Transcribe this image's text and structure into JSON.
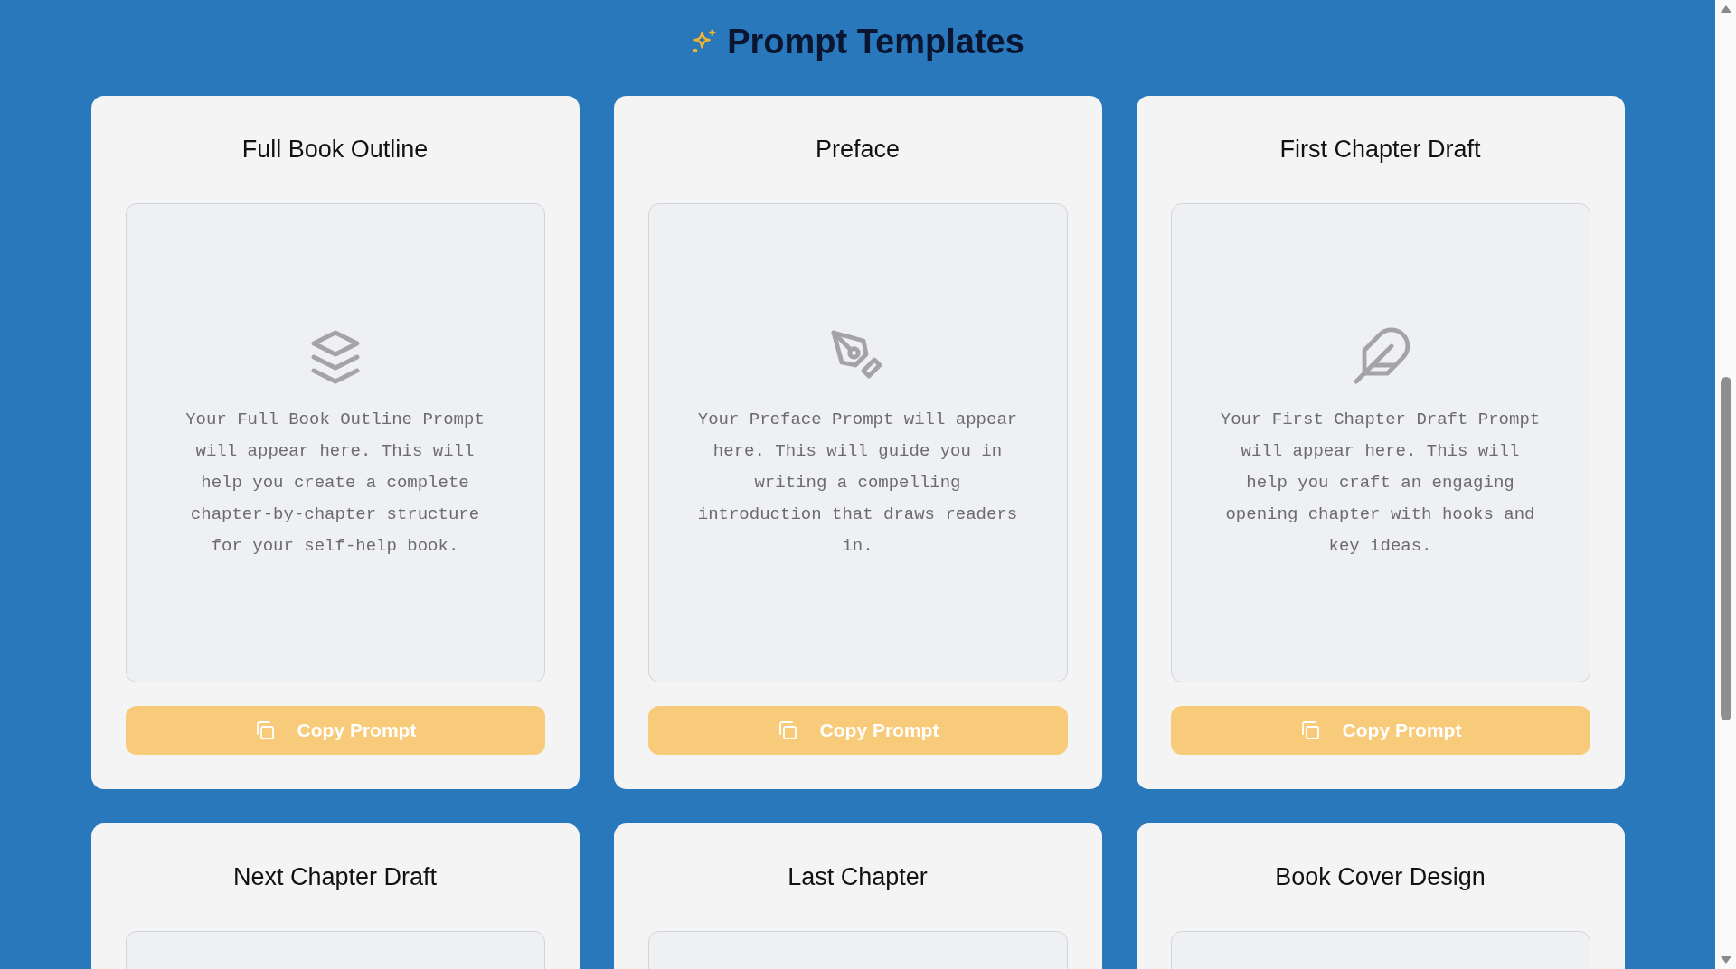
{
  "header": {
    "title": "Prompt Templates"
  },
  "cards": [
    {
      "title": "Full Book Outline",
      "kind": "layers",
      "preview": "Your Full Book Outline Prompt will appear here. This will help you create a complete chapter-by-chapter structure for your self-help book.",
      "button": {
        "label": "Copy Prompt",
        "disabled": true
      }
    },
    {
      "title": "Preface",
      "kind": "pen",
      "preview": "Your Preface Prompt will appear here. This will guide you in writing a compelling introduction that draws readers in.",
      "button": {
        "label": "Copy Prompt",
        "disabled": true
      }
    },
    {
      "title": "First Chapter Draft",
      "kind": "feather",
      "preview": "Your First Chapter Draft Prompt will appear here. This will help you craft an engaging opening chapter with hooks and key ideas.",
      "button": {
        "label": "Copy Prompt",
        "disabled": true
      }
    },
    {
      "title": "Next Chapter Draft"
    },
    {
      "title": "Last Chapter"
    },
    {
      "title": "Book Cover Design"
    }
  ]
}
